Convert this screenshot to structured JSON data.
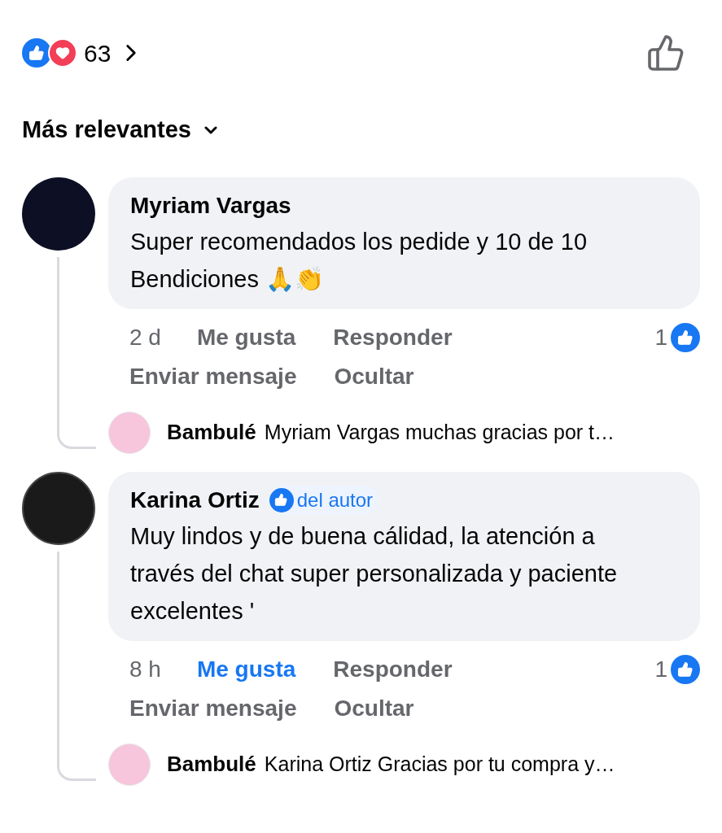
{
  "reactions": {
    "count": "63"
  },
  "sort": {
    "label": "Más relevantes"
  },
  "comments": [
    {
      "author": "Myriam Vargas",
      "text": "Super recomendados los pedide y 10 de 10 Bendiciones 🙏👏",
      "time": "2 d",
      "liked": false,
      "like_label": "Me gusta",
      "reply_label": "Responder",
      "reaction_count": "1",
      "message_label": "Enviar mensaje",
      "hide_label": "Ocultar",
      "reply": {
        "author": "Bambulé",
        "text": "Myriam Vargas muchas gracias por t…"
      }
    },
    {
      "author": "Karina Ortiz",
      "badge": "del autor",
      "text": "Muy lindos y de buena cálidad, la atención a través del chat super personalizada y paciente  excelentes '",
      "time": "8 h",
      "liked": true,
      "like_label": "Me gusta",
      "reply_label": "Responder",
      "reaction_count": "1",
      "message_label": "Enviar mensaje",
      "hide_label": "Ocultar",
      "reply": {
        "author": "Bambulé",
        "text": "Karina Ortiz Gracias por tu compra y…"
      }
    }
  ]
}
